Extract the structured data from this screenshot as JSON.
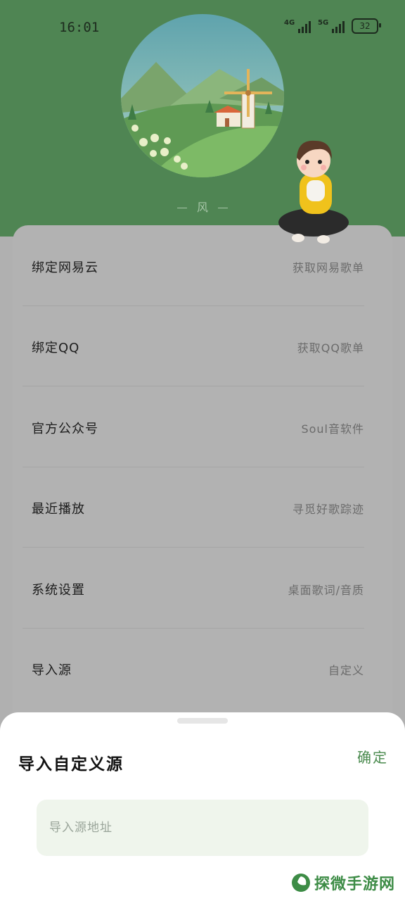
{
  "status_bar": {
    "time": "16:01",
    "net1": "4G",
    "net2": "5G",
    "battery": "32"
  },
  "header": {
    "wind_label": "风"
  },
  "menu": {
    "items": [
      {
        "label": "绑定网易云",
        "value": "获取网易歌单"
      },
      {
        "label": "绑定QQ",
        "value": "获取QQ歌单"
      },
      {
        "label": "官方公众号",
        "value": "Soul音软件"
      },
      {
        "label": "最近播放",
        "value": "寻觅好歌踪迹"
      },
      {
        "label": "系统设置",
        "value": "桌面歌词/音质"
      },
      {
        "label": "导入源",
        "value": "自定义"
      }
    ]
  },
  "dialog": {
    "title": "导入自定义源",
    "confirm_label": "确定",
    "input_placeholder": "导入源地址",
    "input_value": ""
  },
  "watermark": {
    "text": "探微手游网"
  },
  "colors": {
    "header_green": "#4f8553",
    "accent_green": "#4a8a4e",
    "input_bg": "#eff5ec"
  }
}
